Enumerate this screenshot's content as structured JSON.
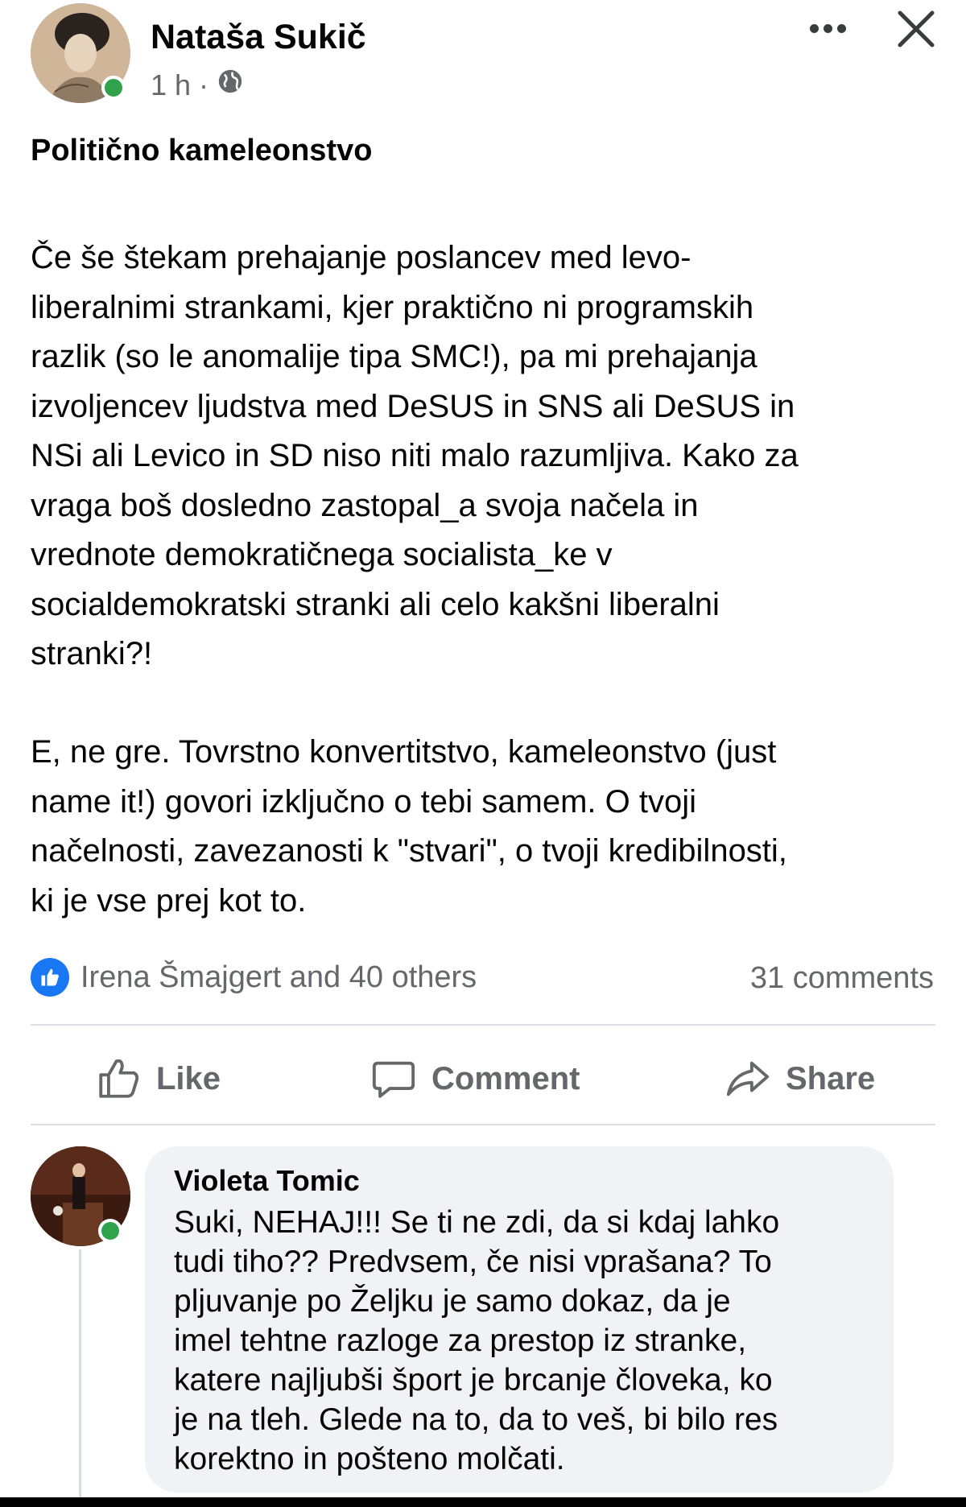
{
  "post": {
    "author_name": "Nataša Sukič",
    "time": "1 h",
    "separator": "·",
    "title": "Politično kameleonstvo",
    "paragraph1_lines": [
      "Če še štekam prehajanje poslancev med levo-",
      "liberalnimi strankami, kjer praktično ni programskih",
      "razlik (so le anomalije tipa SMC!), pa mi prehajanja",
      "izvoljencev ljudstva med DeSUS in SNS ali DeSUS in",
      "NSi ali Levico in SD niso niti malo razumljiva. Kako za",
      "vraga boš dosledno zastopal_a svoja načela in",
      "vrednote demokratičnega socialista_ke v",
      "socialdemokratski stranki ali celo kakšni liberalni",
      "stranki?!"
    ],
    "paragraph2_lines": [
      "E, ne gre. Tovrstno konvertitstvo, kameleonstvo (just",
      "name it!) govori izključno o tebi samem. O tvoji",
      "načelnosti, zavezanosti k \"stvari\", o tvoji kredibilnosti,",
      "ki je vse prej kot to."
    ]
  },
  "reactions": {
    "text": "Irena Šmajgert and 40 others",
    "comments_count": "31 comments"
  },
  "actions": {
    "like": "Like",
    "comment": "Comment",
    "share": "Share"
  },
  "comment": {
    "name": "Violeta Tomic",
    "lines": [
      "Suki, NEHAJ!!!  Se ti ne zdi, da si kdaj lahko",
      "tudi tiho?? Predvsem, če nisi vprašana? To",
      "pljuvanje po Željku je samo dokaz, da je",
      "imel tehtne razloge za prestop iz stranke,",
      "katere najljubši šport je brcanje človeka, ko",
      "je na tleh. Glede na to, da to veš, bi bilo res",
      "korektno in pošteno molčati."
    ]
  },
  "icons": [
    "globe-icon",
    "more-icon",
    "close-icon",
    "like-badge-icon",
    "thumbs-up-icon",
    "comment-bubble-icon",
    "share-arrow-icon"
  ],
  "colors": {
    "accent": "#1877f2",
    "online": "#31a24c",
    "secondary_text": "#65676b",
    "bubble": "#f0f2f5"
  }
}
